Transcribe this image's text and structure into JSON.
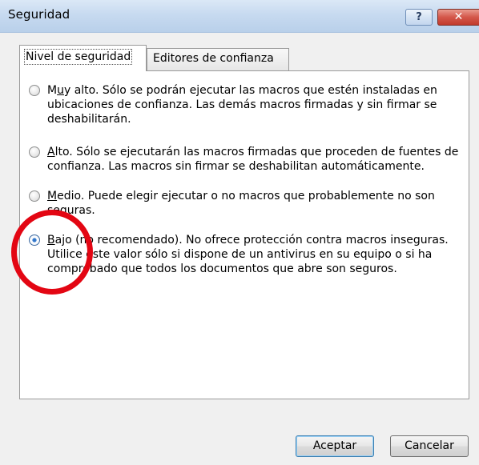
{
  "window": {
    "title": "Seguridad",
    "help_glyph": "?",
    "close_glyph": "✕"
  },
  "tabs": [
    {
      "label": "Nivel de seguridad",
      "selected": true
    },
    {
      "label": "Editores de confianza",
      "selected": false
    }
  ],
  "options": [
    {
      "hotkey": "u",
      "title_pre": "M",
      "title_ul": "u",
      "title_post": "y alto",
      "description": ". Sólo se podrán ejecutar las macros que estén instaladas en ubicaciones de confianza. Las demás macros firmadas y sin firmar se deshabilitarán.",
      "checked": false
    },
    {
      "title_pre": "",
      "title_ul": "A",
      "title_post": "lto",
      "description": ". Sólo se ejecutarán las macros firmadas que proceden de fuentes de confianza. Las macros sin firmar se deshabilitan automáticamente.",
      "checked": false
    },
    {
      "title_pre": "",
      "title_ul": "M",
      "title_post": "edio",
      "description": ". Puede elegir ejecutar o no macros que probablemente no son seguras.",
      "checked": false
    },
    {
      "title_pre": "",
      "title_ul": "B",
      "title_post": "ajo (no recomendado)",
      "description": ". No ofrece protección contra macros inseguras. Utilice este valor sólo si dispone de un antivirus en su equipo o si ha comprobado que todos los documentos que abre son seguros.",
      "checked": true
    }
  ],
  "buttons": {
    "ok_label": "Aceptar",
    "cancel_label": "Cancelar"
  },
  "colors": {
    "annotation": "#e30613",
    "selected_radio": "#2c6fc1"
  }
}
